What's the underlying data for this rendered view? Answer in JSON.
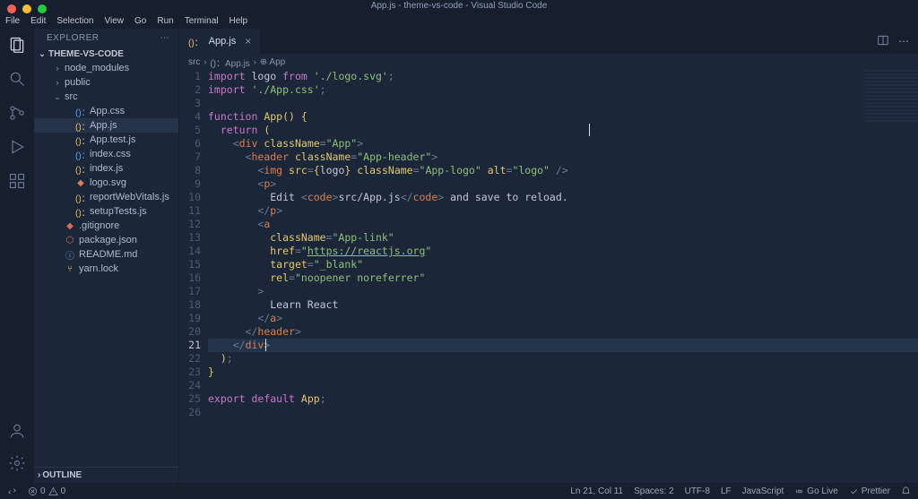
{
  "title": "App.js - theme-vs-code - Visual Studio Code",
  "menu": [
    "File",
    "Edit",
    "Selection",
    "View",
    "Go",
    "Run",
    "Terminal",
    "Help"
  ],
  "sidebar": {
    "title": "EXPLORER",
    "project": "THEME-VS-CODE",
    "outline": "OUTLINE",
    "items": [
      {
        "label": "node_modules",
        "type": "folder",
        "indent": 1,
        "open": false
      },
      {
        "label": "public",
        "type": "folder",
        "indent": 1,
        "open": false
      },
      {
        "label": "src",
        "type": "folder",
        "indent": 1,
        "open": true
      },
      {
        "label": "App.css",
        "type": "css",
        "indent": 2,
        "prefix": "()："
      },
      {
        "label": "App.js",
        "type": "js",
        "indent": 2,
        "prefix": "()：",
        "selected": true
      },
      {
        "label": "App.test.js",
        "type": "js",
        "indent": 2,
        "prefix": "()："
      },
      {
        "label": "index.css",
        "type": "css",
        "indent": 2,
        "prefix": "()："
      },
      {
        "label": "index.js",
        "type": "js",
        "indent": 2,
        "prefix": "()："
      },
      {
        "label": "logo.svg",
        "type": "svg",
        "indent": 2
      },
      {
        "label": "reportWebVitals.js",
        "type": "js",
        "indent": 2,
        "prefix": "()："
      },
      {
        "label": "setupTests.js",
        "type": "js",
        "indent": 2,
        "prefix": "()："
      },
      {
        "label": ".gitignore",
        "type": "git",
        "indent": 1
      },
      {
        "label": "package.json",
        "type": "npm",
        "indent": 1
      },
      {
        "label": "README.md",
        "type": "info",
        "indent": 1
      },
      {
        "label": "yarn.lock",
        "type": "lock",
        "indent": 1
      }
    ]
  },
  "tab": {
    "label": "App.js",
    "prefix": "()："
  },
  "breadcrumb": [
    "src",
    "()：App.js",
    "⊕ App"
  ],
  "code": {
    "current_line": 21,
    "lines": [
      {
        "n": 1,
        "html": "<span class='kw'>import</span> <span class='txt'>logo</span> <span class='kw'>from</span> <span class='str'>'./logo.svg'</span><span class='punct'>;</span>"
      },
      {
        "n": 2,
        "html": "<span class='kw'>import</span> <span class='str'>'./App.css'</span><span class='punct'>;</span>"
      },
      {
        "n": 3,
        "html": ""
      },
      {
        "n": 4,
        "html": "<span class='kw'>function</span> <span class='fn'>App</span><span class='brace'>()</span> <span class='brace'>{</span>"
      },
      {
        "n": 5,
        "html": "  <span class='kw'>return</span> <span class='brace'>(</span>"
      },
      {
        "n": 6,
        "html": "    <span class='punct'>&lt;</span><span class='tag'>div</span> <span class='attr'>className</span><span class='punct'>=</span><span class='str'>\"App\"</span><span class='punct'>&gt;</span>"
      },
      {
        "n": 7,
        "html": "      <span class='punct'>&lt;</span><span class='tag'>header</span> <span class='attr'>className</span><span class='punct'>=</span><span class='str'>\"App-header\"</span><span class='punct'>&gt;</span>"
      },
      {
        "n": 8,
        "html": "        <span class='punct'>&lt;</span><span class='tag'>img</span> <span class='attr'>src</span><span class='punct'>=</span><span class='brace'>{</span><span class='txt'>logo</span><span class='brace'>}</span> <span class='attr'>className</span><span class='punct'>=</span><span class='str'>\"App-logo\"</span> <span class='attr'>alt</span><span class='punct'>=</span><span class='str'>\"logo\"</span> <span class='punct'>/&gt;</span>"
      },
      {
        "n": 9,
        "html": "        <span class='punct'>&lt;</span><span class='tag'>p</span><span class='punct'>&gt;</span>"
      },
      {
        "n": 10,
        "html": "          <span class='txt'>Edit </span><span class='punct'>&lt;</span><span class='tag'>code</span><span class='punct'>&gt;</span><span class='txt'>src/App.js</span><span class='punct'>&lt;/</span><span class='tag'>code</span><span class='punct'>&gt;</span><span class='txt'> and save to reload.</span>"
      },
      {
        "n": 11,
        "html": "        <span class='punct'>&lt;/</span><span class='tag'>p</span><span class='punct'>&gt;</span>"
      },
      {
        "n": 12,
        "html": "        <span class='punct'>&lt;</span><span class='tag'>a</span>"
      },
      {
        "n": 13,
        "html": "          <span class='attr'>className</span><span class='punct'>=</span><span class='str'>\"App-link\"</span>"
      },
      {
        "n": 14,
        "html": "          <span class='attr'>href</span><span class='punct'>=</span><span class='str'>\"</span><span class='link'>https://reactjs.org</span><span class='str'>\"</span>"
      },
      {
        "n": 15,
        "html": "          <span class='attr'>target</span><span class='punct'>=</span><span class='str'>\"_blank\"</span>"
      },
      {
        "n": 16,
        "html": "          <span class='attr'>rel</span><span class='punct'>=</span><span class='str'>\"noopener noreferrer\"</span>"
      },
      {
        "n": 17,
        "html": "        <span class='punct'>&gt;</span>"
      },
      {
        "n": 18,
        "html": "          <span class='txt'>Learn React</span>"
      },
      {
        "n": 19,
        "html": "        <span class='punct'>&lt;/</span><span class='tag'>a</span><span class='punct'>&gt;</span>"
      },
      {
        "n": 20,
        "html": "      <span class='punct'>&lt;/</span><span class='tag'>header</span><span class='punct'>&gt;</span>"
      },
      {
        "n": 21,
        "html": "    <span class='punct'>&lt;/</span><span class='tag'>div</span><span class='punct'>&gt;</span>",
        "highlight": true
      },
      {
        "n": 22,
        "html": "  <span class='brace'>)</span><span class='punct'>;</span>"
      },
      {
        "n": 23,
        "html": "<span class='brace'>}</span>"
      },
      {
        "n": 24,
        "html": ""
      },
      {
        "n": 25,
        "html": "<span class='kw'>export</span> <span class='kw'>default</span> <span class='fn'>App</span><span class='punct'>;</span>"
      },
      {
        "n": 26,
        "html": ""
      }
    ]
  },
  "statusbar": {
    "errors": "0",
    "warnings": "0",
    "position": "Ln 21, Col 11",
    "spaces": "Spaces: 2",
    "encoding": "UTF-8",
    "eol": "LF",
    "language": "JavaScript",
    "golive": "Go Live",
    "prettier": "Prettier"
  }
}
